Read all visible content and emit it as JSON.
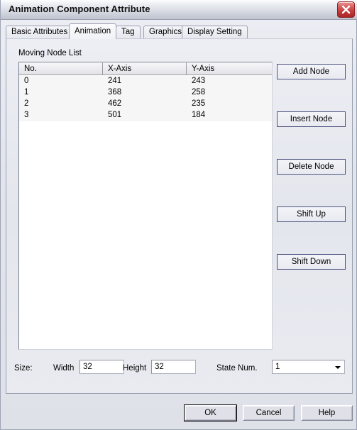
{
  "window": {
    "title": "Animation Component Attribute",
    "close_icon": "close-x-icon"
  },
  "tabs": [
    {
      "label": "Basic Attributes",
      "active": false
    },
    {
      "label": "Animation",
      "active": true
    },
    {
      "label": "Tag",
      "active": false
    },
    {
      "label": "Graphics",
      "active": false
    },
    {
      "label": "Display Setting",
      "active": false
    }
  ],
  "panel": {
    "group_label": "Moving Node List",
    "grid": {
      "columns": [
        "No.",
        "X-Axis",
        "Y-Axis"
      ],
      "rows": [
        [
          "0",
          "241",
          "243"
        ],
        [
          "1",
          "368",
          "258"
        ],
        [
          "2",
          "462",
          "235"
        ],
        [
          "3",
          "501",
          "184"
        ]
      ]
    },
    "side_buttons": [
      "Add Node",
      "Insert Node",
      "Delete Node",
      "Shift Up",
      "Shift Down"
    ],
    "size": {
      "label": "Size:",
      "width_label": "Width",
      "width_value": "32",
      "height_label": "Height",
      "height_value": "32"
    },
    "state": {
      "label": "State Num.",
      "value": "1",
      "arrow_icon": "chevron-down-icon"
    }
  },
  "footer": {
    "ok": "OK",
    "cancel": "Cancel",
    "help": "Help"
  },
  "colors": {
    "dialog_bg": "#e4e6ed",
    "title_text": "#101010",
    "close_red": "#c33b3b",
    "button_border": "#4d5480",
    "row_band": "#f6f6f6"
  }
}
